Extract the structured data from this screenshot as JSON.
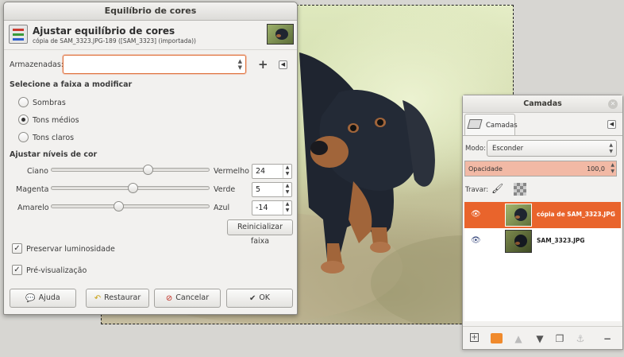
{
  "dialog": {
    "window_title": "Equilíbrio de cores",
    "header_title": "Ajustar equilíbrio de cores",
    "header_subtitle": "cópia de SAM_3323.JPG-189 ([SAM_3323] (importada))",
    "stored_label": "Armazenadas:",
    "stored_value": "",
    "range_section": "Selecione a faixa a modificar",
    "ranges": [
      "Sombras",
      "Tons médios",
      "Tons claros"
    ],
    "selected_range": "Tons médios",
    "levels_section": "Ajustar níveis de cor",
    "sliders": [
      {
        "left": "Ciano",
        "right": "Vermelho",
        "value": "24"
      },
      {
        "left": "Magenta",
        "right": "Verde",
        "value": "5"
      },
      {
        "left": "Amarelo",
        "right": "Azul",
        "value": "-14"
      }
    ],
    "reset_range_label": "Reinicializar faixa",
    "preserve_luminosity_label": "Preservar luminosidade",
    "preview_label": "Pré-visualização",
    "buttons": {
      "help": "Ajuda",
      "restore": "Restaurar",
      "cancel": "Cancelar",
      "ok": "OK"
    }
  },
  "layers_dock": {
    "title": "Camadas",
    "tab_label": "Camadas",
    "mode_label": "Modo:",
    "mode_value": "Esconder",
    "opacity_label": "Opacidade",
    "opacity_value": "100,0",
    "lock_label": "Travar:",
    "layers": [
      {
        "name": "cópia de SAM_3323.JPG",
        "active": true
      },
      {
        "name": "SAM_3323.JPG",
        "active": false
      }
    ]
  },
  "colors": {
    "accent": "#e9642c",
    "opacity_fill": "#f2b9a5"
  }
}
